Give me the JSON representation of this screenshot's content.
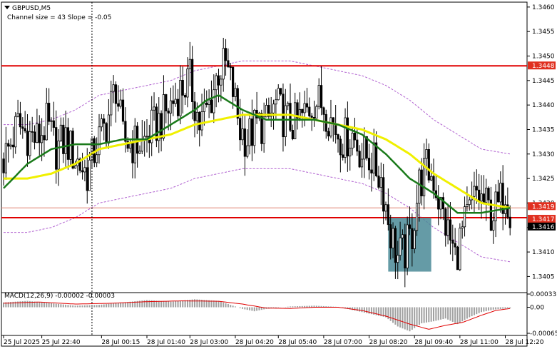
{
  "header": {
    "symbol": "GBPUSD,M5",
    "indicator": "Channel size = 43 Slope = -0.05"
  },
  "macd": {
    "label": "MACD(12,26,9) -0.00002 -0.00003",
    "ticks": [
      "0.00033",
      "0.00",
      "-0.00065"
    ],
    "tick_values": [
      0.00033,
      0.0,
      -0.00065
    ]
  },
  "colors": {
    "bull": "#000000",
    "bear": "#000000",
    "ma_fast": "#1a7a1a",
    "ma_slow": "#f0f000",
    "channel": "#b060d0",
    "level_line": "#e00000",
    "price_badge": "#e03020",
    "current_badge": "#000000",
    "highlight_box": "#4a8a96",
    "macd_hist": "#a0a0a0",
    "macd_signal": "#e00000",
    "session_sep": "#000000"
  },
  "chart_data": {
    "type": "candlestick",
    "symbol": "GBPUSD",
    "timeframe": "M5",
    "ylim": [
      1.3402,
      1.3461
    ],
    "y_ticks": [
      1.346,
      1.3455,
      1.345,
      1.3445,
      1.344,
      1.3435,
      1.343,
      1.3425,
      1.342,
      1.3415,
      1.341,
      1.3405
    ],
    "y_tick_labels": [
      "1.3460",
      "1.3455",
      "1.3450",
      "1.3445",
      "1.3440",
      "1.3435",
      "1.3430",
      "1.3425",
      "1.3420",
      "1.3415",
      "1.3410",
      "1.3405"
    ],
    "x_labels": [
      "25 Jul 2025",
      "25 Jul 22:40",
      "28 Jul 00:15",
      "28 Jul 01:40",
      "28 Jul 03:00",
      "28 Jul 04:20",
      "28 Jul 05:40",
      "28 Jul 07:00",
      "28 Jul 08:20",
      "28 Jul 09:40",
      "28 Jul 11:00",
      "28 Jul 12:20"
    ],
    "x_label_index": [
      0,
      16,
      41,
      60,
      78,
      97,
      115,
      134,
      153,
      172,
      191,
      210
    ],
    "session_separator_index": 37,
    "levels": [
      {
        "name": "upper",
        "price": 1.3448,
        "label": "1.3448"
      },
      {
        "name": "lower",
        "price": 1.3417,
        "label": "1.3417"
      }
    ],
    "price_markers": [
      {
        "name": "bid",
        "price": 1.3419,
        "label": "1.3419"
      },
      {
        "name": "level",
        "price": 1.3417,
        "label": "1.3417"
      },
      {
        "name": "current",
        "price": 1.3416,
        "label": "1.3416"
      }
    ],
    "highlight_zone": {
      "from_index": 161,
      "to_index": 179,
      "price_high": 1.3417,
      "price_low": 1.3406
    },
    "anchors": [
      [
        0,
        1.3429
      ],
      [
        2,
        1.3431
      ],
      [
        6,
        1.3436
      ],
      [
        10,
        1.3434
      ],
      [
        14,
        1.3433
      ],
      [
        18,
        1.3436
      ],
      [
        22,
        1.3431
      ],
      [
        26,
        1.3433
      ],
      [
        30,
        1.3429
      ],
      [
        35,
        1.3426
      ],
      [
        39,
        1.3432
      ],
      [
        43,
        1.3436
      ],
      [
        47,
        1.3444
      ],
      [
        50,
        1.3433
      ],
      [
        54,
        1.3432
      ],
      [
        58,
        1.3432
      ],
      [
        62,
        1.3435
      ],
      [
        66,
        1.3437
      ],
      [
        70,
        1.344
      ],
      [
        74,
        1.3443
      ],
      [
        78,
        1.3445
      ],
      [
        82,
        1.3436
      ],
      [
        86,
        1.344
      ],
      [
        90,
        1.3447
      ],
      [
        93,
        1.3448
      ],
      [
        96,
        1.3443
      ],
      [
        99,
        1.3435
      ],
      [
        102,
        1.3433
      ],
      [
        106,
        1.3436
      ],
      [
        110,
        1.3436
      ],
      [
        114,
        1.344
      ],
      [
        118,
        1.3437
      ],
      [
        122,
        1.3436
      ],
      [
        126,
        1.3438
      ],
      [
        130,
        1.3441
      ],
      [
        134,
        1.344
      ],
      [
        138,
        1.3436
      ],
      [
        142,
        1.3433
      ],
      [
        146,
        1.3434
      ],
      [
        150,
        1.343
      ],
      [
        154,
        1.3429
      ],
      [
        158,
        1.3425
      ],
      [
        162,
        1.3414
      ],
      [
        165,
        1.3409
      ],
      [
        168,
        1.341
      ],
      [
        171,
        1.3414
      ],
      [
        174,
        1.3424
      ],
      [
        177,
        1.3427
      ],
      [
        180,
        1.3425
      ],
      [
        183,
        1.3419
      ],
      [
        186,
        1.3414
      ],
      [
        189,
        1.3409
      ],
      [
        192,
        1.3414
      ],
      [
        195,
        1.3418
      ],
      [
        198,
        1.3422
      ],
      [
        201,
        1.342
      ],
      [
        204,
        1.3418
      ],
      [
        207,
        1.3419
      ],
      [
        210,
        1.3423
      ],
      [
        212,
        1.3419
      ]
    ],
    "ma_fast": [
      [
        0,
        1.3423
      ],
      [
        10,
        1.3428
      ],
      [
        20,
        1.3431
      ],
      [
        30,
        1.3432
      ],
      [
        40,
        1.3432
      ],
      [
        50,
        1.3433
      ],
      [
        60,
        1.3433
      ],
      [
        70,
        1.3436
      ],
      [
        80,
        1.3439
      ],
      [
        85,
        1.3441
      ],
      [
        90,
        1.3442
      ],
      [
        100,
        1.3439
      ],
      [
        110,
        1.3437
      ],
      [
        120,
        1.3437
      ],
      [
        130,
        1.3437
      ],
      [
        140,
        1.3436
      ],
      [
        150,
        1.3434
      ],
      [
        160,
        1.343
      ],
      [
        170,
        1.3425
      ],
      [
        180,
        1.3422
      ],
      [
        190,
        1.3418
      ],
      [
        200,
        1.3418
      ],
      [
        212,
        1.3419
      ]
    ],
    "ma_slow": [
      [
        0,
        1.3425
      ],
      [
        10,
        1.3425
      ],
      [
        20,
        1.3426
      ],
      [
        30,
        1.3428
      ],
      [
        40,
        1.3431
      ],
      [
        50,
        1.3432
      ],
      [
        60,
        1.3433
      ],
      [
        70,
        1.3434
      ],
      [
        80,
        1.3436
      ],
      [
        90,
        1.3437
      ],
      [
        100,
        1.3438
      ],
      [
        110,
        1.3438
      ],
      [
        120,
        1.3438
      ],
      [
        130,
        1.3437
      ],
      [
        140,
        1.3436
      ],
      [
        150,
        1.3435
      ],
      [
        160,
        1.3433
      ],
      [
        170,
        1.343
      ],
      [
        180,
        1.3426
      ],
      [
        190,
        1.3423
      ],
      [
        200,
        1.342
      ],
      [
        212,
        1.3419
      ]
    ],
    "channel_width": 0.0011,
    "macd_hist": [
      [
        0,
        0.00012
      ],
      [
        10,
        0.00016
      ],
      [
        20,
        0.0001
      ],
      [
        30,
        4e-05
      ],
      [
        40,
        6e-05
      ],
      [
        50,
        0.00012
      ],
      [
        60,
        0.00018
      ],
      [
        70,
        0.00014
      ],
      [
        80,
        0.0002
      ],
      [
        90,
        0.00016
      ],
      [
        100,
        -4e-05
      ],
      [
        105,
        -0.0001
      ],
      [
        110,
        -4e-05
      ],
      [
        120,
        2e-05
      ],
      [
        130,
        4e-05
      ],
      [
        140,
        1e-05
      ],
      [
        150,
        -0.00012
      ],
      [
        160,
        -0.00025
      ],
      [
        165,
        -0.00048
      ],
      [
        170,
        -0.0006
      ],
      [
        175,
        -0.0004
      ],
      [
        180,
        -0.00035
      ],
      [
        185,
        -0.00028
      ],
      [
        190,
        -0.00042
      ],
      [
        195,
        -0.00025
      ],
      [
        200,
        -0.00012
      ],
      [
        205,
        -6e-05
      ],
      [
        212,
        -2e-05
      ]
    ],
    "macd_signal": [
      [
        0,
        0.0001
      ],
      [
        15,
        0.00013
      ],
      [
        30,
        8e-05
      ],
      [
        45,
        0.0001
      ],
      [
        60,
        0.00014
      ],
      [
        75,
        0.00016
      ],
      [
        90,
        0.00015
      ],
      [
        100,
        8e-05
      ],
      [
        110,
        -2e-05
      ],
      [
        120,
        -3e-05
      ],
      [
        130,
        0.0
      ],
      [
        140,
        0.0
      ],
      [
        150,
        -8e-05
      ],
      [
        160,
        -0.00022
      ],
      [
        170,
        -0.00042
      ],
      [
        178,
        -0.00055
      ],
      [
        185,
        -0.00045
      ],
      [
        192,
        -0.00038
      ],
      [
        200,
        -0.0002
      ],
      [
        206,
        -8e-05
      ],
      [
        212,
        -3e-05
      ]
    ]
  }
}
